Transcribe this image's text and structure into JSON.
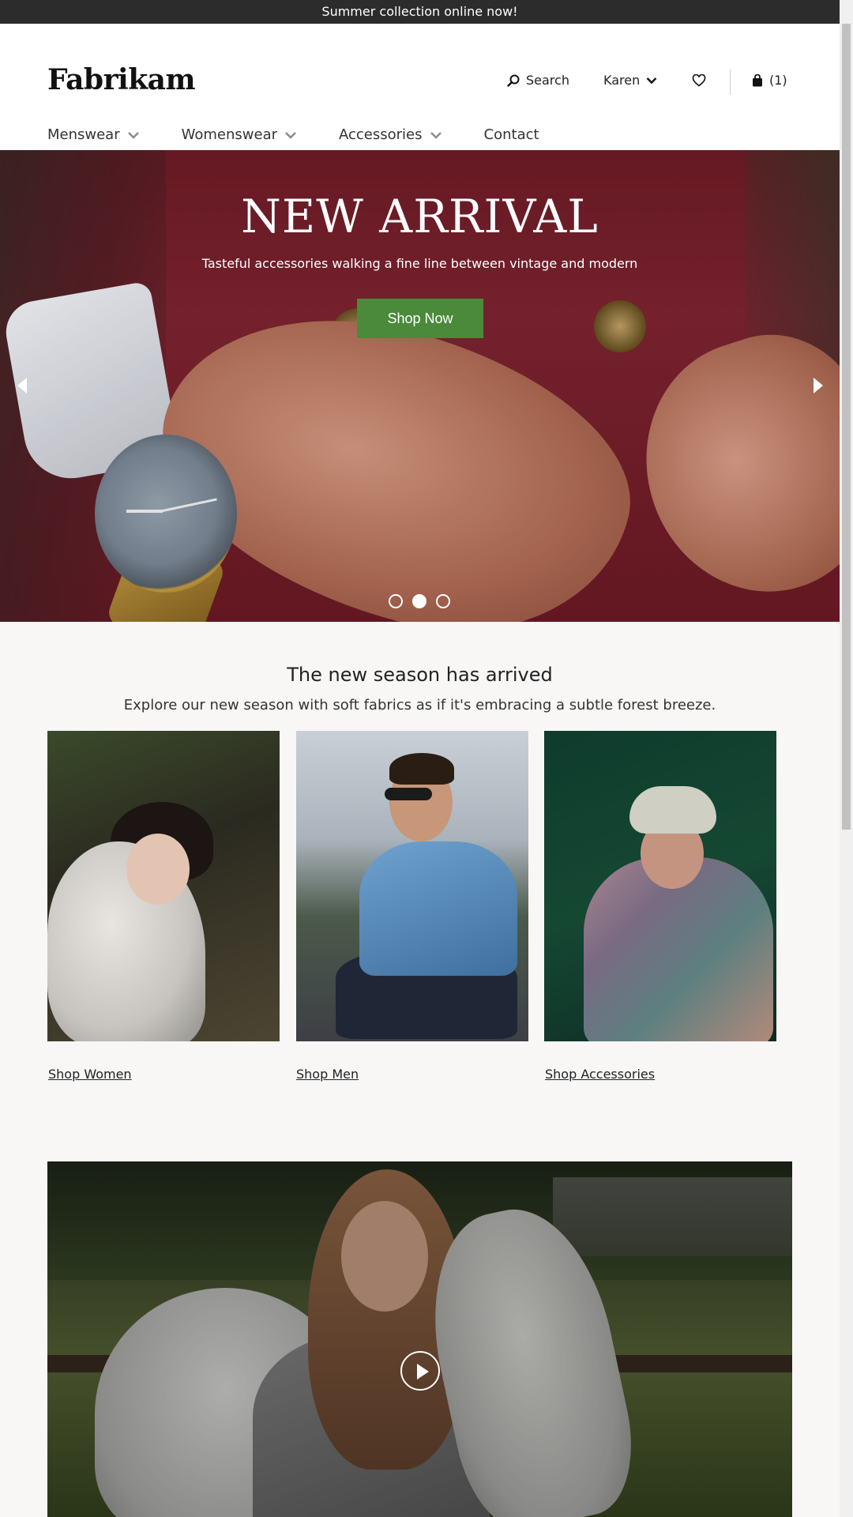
{
  "announcement": "Summer collection online now!",
  "brand": "Fabrikam",
  "utility": {
    "search_label": "Search",
    "user_label": "Karen",
    "cart_label": "(1)"
  },
  "nav": {
    "items": [
      {
        "label": "Menswear"
      },
      {
        "label": "Womenswear"
      },
      {
        "label": "Accessories"
      },
      {
        "label": "Contact"
      }
    ]
  },
  "hero": {
    "title": "NEW ARRIVAL",
    "subtitle": "Tasteful accessories walking a fine line between vintage and modern",
    "cta_label": "Shop Now",
    "active_slide": 2,
    "slide_count": 3
  },
  "season": {
    "title": "The new season has arrived",
    "subtitle": "Explore our new season with soft fabrics as if it's embracing a subtle forest breeze."
  },
  "cards": [
    {
      "link": "Shop Women"
    },
    {
      "link": "Shop Men"
    },
    {
      "link": "Shop Accessories"
    }
  ],
  "colors": {
    "announcement_bg": "#2c2c2c",
    "cta_bg": "#4a8a3a"
  },
  "icons": {
    "search": "search-icon",
    "user_dropdown": "chevron-down-icon",
    "wishlist": "heart-icon",
    "cart": "shopping-bag-icon",
    "prev": "chevron-left-icon",
    "next": "chevron-right-icon",
    "play": "play-icon"
  }
}
